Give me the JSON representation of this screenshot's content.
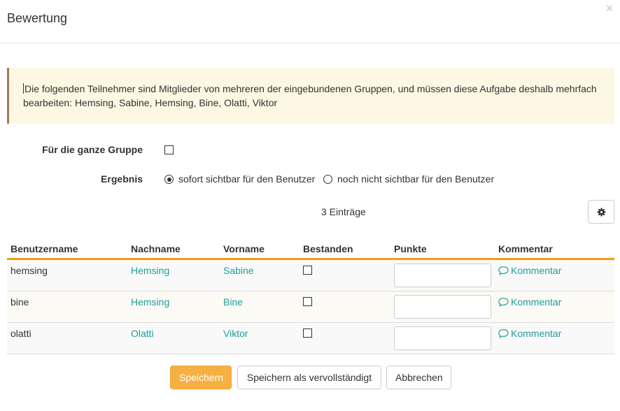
{
  "dialog": {
    "title": "Bewertung",
    "close_symbol": "×"
  },
  "warning": {
    "text": "Die folgenden Teilnehmer sind Mitglieder von mehreren der eingebundenen Gruppen, und müssen diese Aufgabe deshalb mehrfach bearbeiten: Hemsing, Sabine, Hemsing, Bine, Olatti, Viktor"
  },
  "form": {
    "whole_group_label": "Für die ganze Gruppe",
    "whole_group_checked": false,
    "result_label": "Ergebnis",
    "result_options": [
      {
        "label": "sofort sichtbar für den Benutzer",
        "selected": true
      },
      {
        "label": "noch nicht sichtbar für den Benutzer",
        "selected": false
      }
    ]
  },
  "table": {
    "entries_label": "3 Einträge",
    "settings_icon": "gear-icon",
    "columns": [
      "Benutzername",
      "Nachname",
      "Vorname",
      "Bestanden",
      "Punkte",
      "Kommentar"
    ],
    "rows": [
      {
        "username": "hemsing",
        "lastname": "Hemsing",
        "firstname": "Sabine",
        "passed": false,
        "points": "",
        "comment": "Kommentar"
      },
      {
        "username": "bine",
        "lastname": "Hemsing",
        "firstname": "Bine",
        "passed": false,
        "points": "",
        "comment": "Kommentar"
      },
      {
        "username": "olatti",
        "lastname": "Olatti",
        "firstname": "Viktor",
        "passed": false,
        "points": "",
        "comment": "Kommentar"
      }
    ]
  },
  "buttons": {
    "save": "Speichern",
    "save_complete": "Speichern als vervollständigt",
    "cancel": "Abbrechen"
  },
  "colors": {
    "primary": "#f6b042",
    "link": "#209d9d",
    "header_rule": "#f39c12",
    "warning_bg": "#fcf8e3"
  }
}
